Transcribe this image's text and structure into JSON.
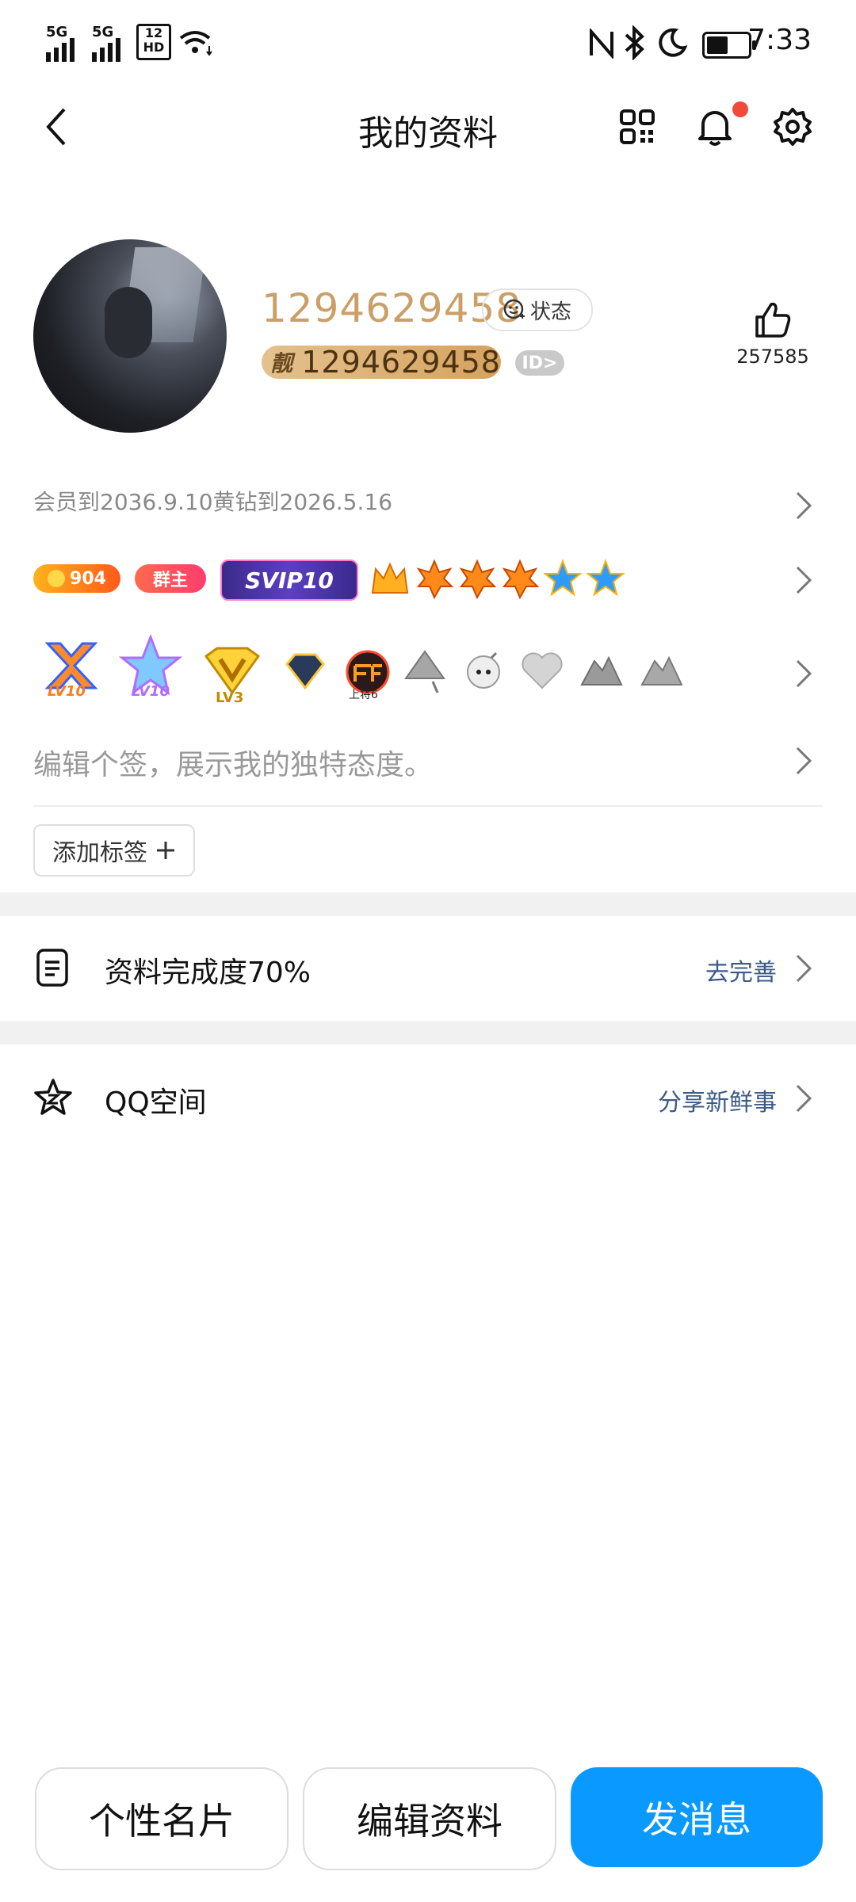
{
  "status_bar": {
    "sim1": "5G",
    "sim2": "5G",
    "hd_top": "12",
    "hd_bottom": "HD",
    "time": "7:33"
  },
  "nav": {
    "title": "我的资料"
  },
  "profile": {
    "nickname": "1294629458",
    "status_chip": "状态",
    "pretty_tag": "靓",
    "pretty_number": "1294629458",
    "id_badge": "ID>",
    "like_count": "257585"
  },
  "vip_line": "会员到2036.9.10黄钻到2026.5.16",
  "badges_row1": {
    "level_pill": "904",
    "group_owner": "群主",
    "svip": "SVIP10"
  },
  "badges_row2": {
    "lv1": "LV10",
    "lv2": "LV10",
    "lv3": "LV3",
    "rank": "上将6"
  },
  "signature_placeholder": "编辑个签，展示我的独特态度。",
  "add_tag": "添加标签",
  "completion": {
    "label": "资料完成度70%",
    "link": "去完善"
  },
  "qzone": {
    "label": "QQ空间",
    "link": "分享新鲜事"
  },
  "buttons": {
    "card": "个性名片",
    "edit": "编辑资料",
    "message": "发消息"
  },
  "colors": {
    "accent": "#0a99ff",
    "nickname": "#caa068",
    "link": "#3b5a86",
    "notification_dot": "#f04a3a"
  }
}
